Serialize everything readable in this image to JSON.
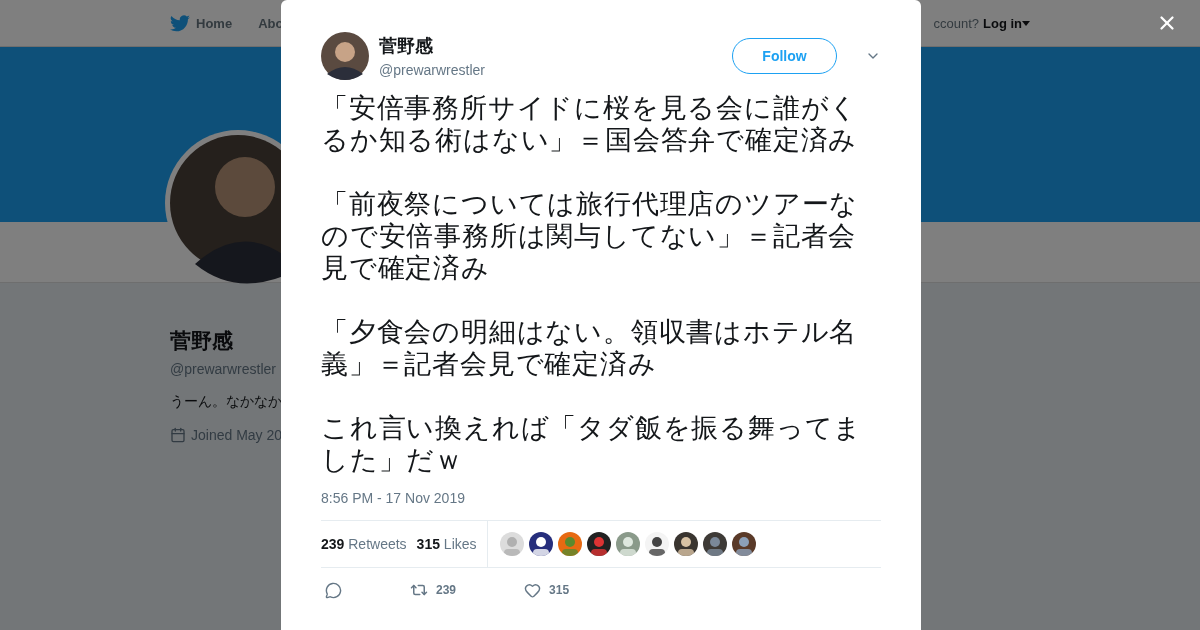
{
  "nav": {
    "items": [
      {
        "label": "Home",
        "kind": "home"
      },
      {
        "label": "Abo",
        "kind": "plain"
      }
    ],
    "account_prompt": "ccount?",
    "login": "Log in"
  },
  "profile": {
    "name": "菅野感",
    "handle": "@prewarwrestler",
    "bio": "うーん。なかなか",
    "joined": "Joined May 20"
  },
  "tweet": {
    "author": {
      "name": "菅野感",
      "handle": "@prewarwrestler"
    },
    "follow_label": "Follow",
    "paragraphs": [
      "「安倍事務所サイドに桜を見る会に誰がくるか知る術はない」＝国会答弁で確定済み",
      "「前夜祭については旅行代理店のツアーなので安倍事務所は関与してない」＝記者会見で確定済み",
      "「夕食会の明細はない。領収書はホテル名義」＝記者会見で確定済み",
      "これ言い換えれば「タダ飯を振る舞ってました」だｗ"
    ],
    "timestamp": "8:56 PM - 17 Nov 2019",
    "stats": [
      {
        "count": "239",
        "label": "Retweets"
      },
      {
        "count": "315",
        "label": "Likes"
      }
    ],
    "actions": [
      {
        "kind": "reply"
      },
      {
        "kind": "retweet",
        "count": "239"
      },
      {
        "kind": "like",
        "count": "315"
      }
    ]
  }
}
